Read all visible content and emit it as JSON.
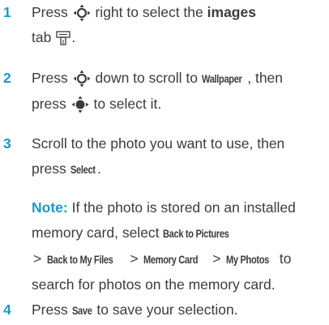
{
  "steps": [
    {
      "number": "1",
      "line1_a": "Press",
      "line1_b": "right to select the",
      "line1_bold": "images",
      "line2_a": "tab",
      "line2_b": "."
    },
    {
      "number": "2",
      "line1_a": "Press",
      "line1_b": "down to scroll to",
      "line1_key": "Wallpaper",
      "line1_c": ", then",
      "line2_a": "press",
      "line2_b": "to select it."
    },
    {
      "number": "3",
      "line1": "Scroll to the photo you want to use, then",
      "line2_a": "press",
      "line2_key": "Select",
      "line2_b": "."
    },
    {
      "number": "4",
      "text_a": "Press",
      "key": "Save",
      "text_b": "to save your selection."
    }
  ],
  "note": {
    "label": "Note:",
    "line1": "If the photo is stored on an installed",
    "line2_a": "memory card, select",
    "line2_key": "Back to Pictures",
    "line3_gt1": ">",
    "line3_key1": "Back to My Files",
    "line3_gt2": ">",
    "line3_key2": "Memory Card",
    "line3_gt3": ">",
    "line3_key3": "My Photos",
    "line3_b": "to",
    "line4": "search for photos on the memory card."
  },
  "icons": {
    "nav_key": "nav-key-icon",
    "center_select_key": "center-select-key-icon",
    "images_tab": "images-tab-icon"
  },
  "colors": {
    "accent": "#2196c8",
    "text": "#3c3c3c"
  }
}
